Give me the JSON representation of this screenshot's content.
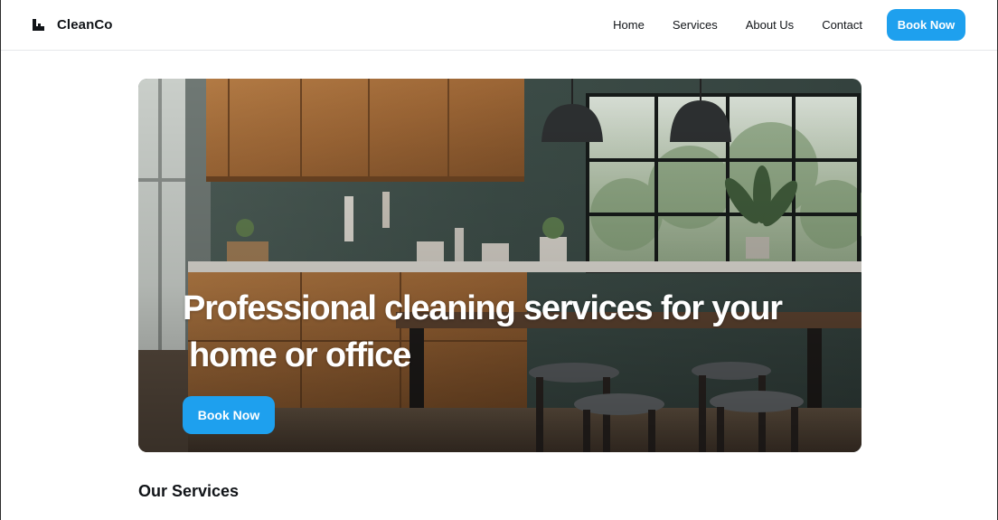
{
  "header": {
    "brand_name": "CleanCo",
    "logo_icon": "brand-logo-icon",
    "nav": [
      {
        "label": "Home"
      },
      {
        "label": "Services"
      },
      {
        "label": "About Us"
      },
      {
        "label": "Contact"
      }
    ],
    "cta_label": "Book Now"
  },
  "hero": {
    "image": "kitchen-interior-photo",
    "title_line1": "Professional cleaning services for your",
    "title_line2": "home or office",
    "cta_label": "Book Now"
  },
  "services": {
    "title": "Our Services"
  },
  "colors": {
    "accent": "#1ea0ee",
    "text": "#111418",
    "divider": "#e6e8eb"
  }
}
